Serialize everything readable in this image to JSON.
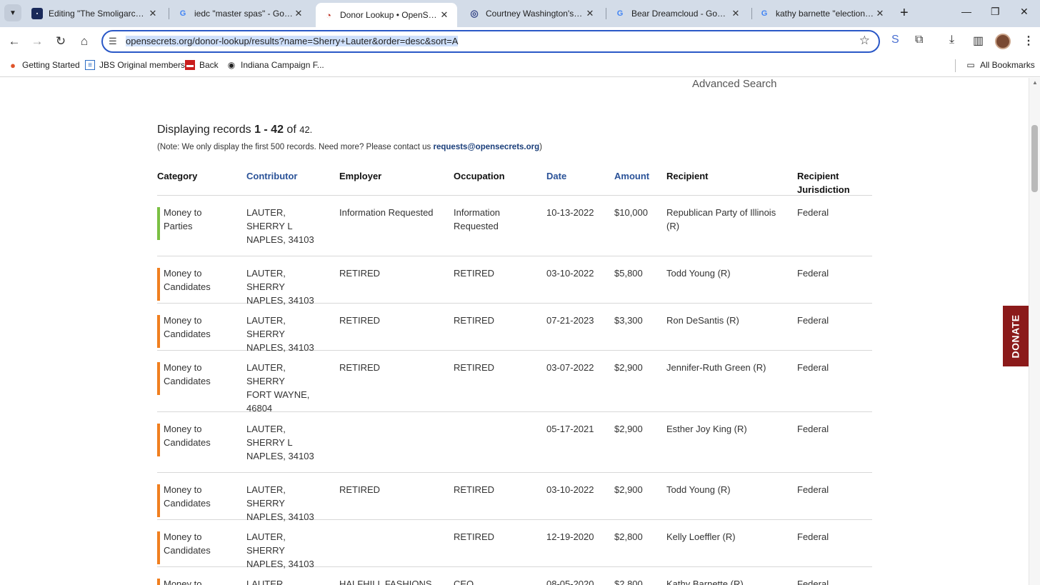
{
  "browser": {
    "tabs": [
      {
        "title": "Editing \"The Smoligarchs: Ro",
        "favicon": "blog-favicon-icon",
        "active": false
      },
      {
        "title": "iedc \"master spas\" - Google S",
        "favicon": "google-icon",
        "active": false
      },
      {
        "title": "Donor Lookup • OpenSecrets",
        "favicon": "opensecrets-icon",
        "active": true
      },
      {
        "title": "Courtney Washington's journ",
        "favicon": "spiral-icon",
        "active": false
      },
      {
        "title": "Bear Dreamcloud - Google S",
        "favicon": "google-icon",
        "active": false
      },
      {
        "title": "kathy barnette \"election deni",
        "favicon": "google-icon",
        "active": false
      }
    ],
    "url": "opensecrets.org/donor-lookup/results?name=Sherry+Lauter&order=desc&sort=A",
    "bookmarks": [
      {
        "label": "Getting Started",
        "icon": "firefox-icon"
      },
      {
        "label": "JBS Original members",
        "icon": "document-icon"
      },
      {
        "label": "Back",
        "icon": "red-book-icon"
      },
      {
        "label": "Indiana Campaign F...",
        "icon": "globe-icon"
      }
    ],
    "all_bookmarks_label": "All Bookmarks"
  },
  "page": {
    "advanced_search": "Advanced Search",
    "displaying_prefix": "Displaying records ",
    "displaying_range": "1 - 42",
    "displaying_of": " of ",
    "displaying_total": "42.",
    "note_text": "(Note: We only display the first 500 records. Need more? Please contact us ",
    "note_email": "requests@opensecrets.org",
    "note_close": ")",
    "donate_label": "DONATE",
    "colors": {
      "parties": "#7bc043",
      "candidates": "#f07f1f",
      "link": "#2a5298",
      "donate": "#8b1a1a"
    }
  },
  "table": {
    "headers": [
      "Category",
      "Contributor",
      "Employer",
      "Occupation",
      "Date",
      "Amount",
      "Recipient",
      "Recipient Jurisdiction"
    ],
    "rows": [
      {
        "category": "Money to Parties",
        "cat_type": "parties",
        "contributor": "LAUTER, SHERRY L",
        "location": "NAPLES, 34103",
        "employer": "Information Requested",
        "occupation": "Information Requested",
        "date": "10-13-2022",
        "amount": "$10,000",
        "recipient": "Republican Party of Illinois (R)",
        "jurisdiction": "Federal"
      },
      {
        "category": "Money to Candidates",
        "cat_type": "candidates",
        "contributor": "LAUTER, SHERRY",
        "location": "NAPLES, 34103",
        "employer": "RETIRED",
        "occupation": "RETIRED",
        "date": "03-10-2022",
        "amount": "$5,800",
        "recipient": "Todd Young (R)",
        "jurisdiction": "Federal"
      },
      {
        "category": "Money to Candidates",
        "cat_type": "candidates",
        "contributor": "LAUTER, SHERRY",
        "location": "NAPLES, 34103",
        "employer": "RETIRED",
        "occupation": "RETIRED",
        "date": "07-21-2023",
        "amount": "$3,300",
        "recipient": "Ron DeSantis (R)",
        "jurisdiction": "Federal"
      },
      {
        "category": "Money to Candidates",
        "cat_type": "candidates",
        "contributor": "LAUTER, SHERRY",
        "location": "FORT WAYNE, 46804",
        "employer": "RETIRED",
        "occupation": "RETIRED",
        "date": "03-07-2022",
        "amount": "$2,900",
        "recipient": "Jennifer-Ruth Green (R)",
        "jurisdiction": "Federal"
      },
      {
        "category": "Money to Candidates",
        "cat_type": "candidates",
        "contributor": "LAUTER, SHERRY L",
        "location": "NAPLES, 34103",
        "employer": "",
        "occupation": "",
        "date": "05-17-2021",
        "amount": "$2,900",
        "recipient": "Esther Joy King (R)",
        "jurisdiction": "Federal"
      },
      {
        "category": "Money to Candidates",
        "cat_type": "candidates",
        "contributor": "LAUTER, SHERRY",
        "location": "NAPLES, 34103",
        "employer": "RETIRED",
        "occupation": "RETIRED",
        "date": "03-10-2022",
        "amount": "$2,900",
        "recipient": "Todd Young (R)",
        "jurisdiction": "Federal"
      },
      {
        "category": "Money to Candidates",
        "cat_type": "candidates",
        "contributor": "LAUTER, SHERRY",
        "location": "NAPLES, 34103",
        "employer": "",
        "occupation": "RETIRED",
        "date": "12-19-2020",
        "amount": "$2,800",
        "recipient": "Kelly Loeffler (R)",
        "jurisdiction": "Federal"
      },
      {
        "category": "Money to Candidates",
        "cat_type": "candidates",
        "contributor": "LAUTER, SHERRY",
        "location": "",
        "employer": "HALFHILL FASHIONS",
        "occupation": "CEO",
        "date": "08-05-2020",
        "amount": "$2,800",
        "recipient": "Kathy Barnette (R)",
        "jurisdiction": "Federal"
      }
    ]
  }
}
